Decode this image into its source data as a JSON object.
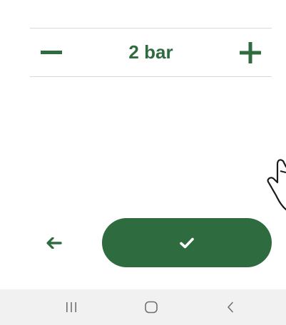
{
  "stepper": {
    "value_label": "2 bar",
    "decrement_icon": "minus-icon",
    "increment_icon": "plus-icon"
  },
  "actions": {
    "back_icon": "arrow-left-icon",
    "confirm_icon": "checkmark-icon"
  },
  "overlay": {
    "hint_icon": "pointing-hand-icon"
  },
  "system_nav": {
    "items": [
      "recents-icon",
      "home-icon",
      "back-icon"
    ]
  },
  "colors": {
    "accent": "#2e6b3f",
    "divider": "#d9d9d9",
    "navbar_bg": "#f1f1f1",
    "nav_icon": "#707070"
  }
}
